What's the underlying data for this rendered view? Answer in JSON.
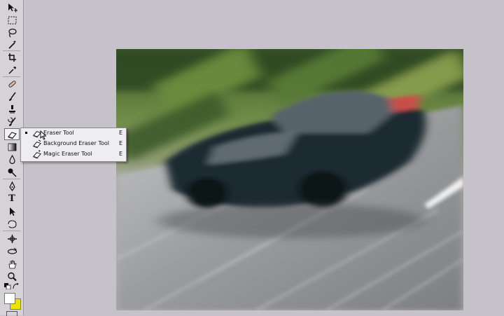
{
  "toolbox": {
    "tools": [
      {
        "name": "move-tool",
        "icon": "move-icon"
      },
      {
        "name": "marquee-tool",
        "icon": "marquee-icon"
      },
      {
        "name": "lasso-tool",
        "icon": "lasso-icon"
      },
      {
        "name": "magic-wand-tool",
        "icon": "magic-wand-icon"
      },
      {
        "name": "crop-tool",
        "icon": "crop-icon"
      },
      {
        "name": "eyedropper-tool",
        "icon": "eyedropper-icon"
      },
      {
        "name": "healing-brush-tool",
        "icon": "bandage-icon"
      },
      {
        "name": "brush-tool",
        "icon": "brush-icon"
      },
      {
        "name": "clone-stamp-tool",
        "icon": "stamp-icon"
      },
      {
        "name": "history-brush-tool",
        "icon": "history-brush-icon"
      },
      {
        "name": "eraser-tool",
        "icon": "eraser-icon",
        "active": true
      },
      {
        "name": "gradient-tool",
        "icon": "gradient-icon"
      },
      {
        "name": "blur-tool",
        "icon": "drop-icon"
      },
      {
        "name": "dodge-tool",
        "icon": "dodge-icon"
      },
      {
        "name": "pen-tool",
        "icon": "pen-icon"
      },
      {
        "name": "type-tool",
        "icon": "type-icon",
        "glyph": "T"
      },
      {
        "name": "path-selection-tool",
        "icon": "arrow-icon"
      },
      {
        "name": "shape-tool",
        "icon": "shape-icon"
      },
      {
        "name": "notes-tool",
        "icon": "notes-icon"
      },
      {
        "name": "3d-rotate-tool",
        "icon": "3d-rotate-icon"
      },
      {
        "name": "hand-tool",
        "icon": "hand-icon"
      },
      {
        "name": "zoom-tool",
        "icon": "zoom-icon"
      }
    ],
    "foreground_color": "#ffffff",
    "background_color": "#e9e400"
  },
  "flyout": {
    "items": [
      {
        "label": "Eraser Tool",
        "shortcut": "E",
        "selected": true
      },
      {
        "label": "Background Eraser Tool",
        "shortcut": "E",
        "selected": false
      },
      {
        "label": "Magic Eraser Tool",
        "shortcut": "E",
        "selected": false
      }
    ]
  },
  "canvas": {
    "background": "#c6c2c9"
  }
}
